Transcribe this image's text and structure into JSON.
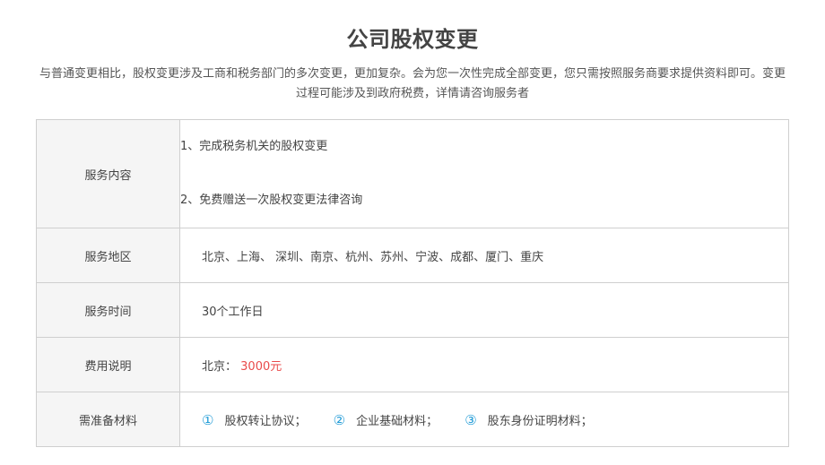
{
  "title": "公司股权变更",
  "intro": "与普通变更相比，股权变更涉及工商和税务部门的多次变更，更加复杂。会为您一次性完成全部变更，您只需按照服务商要求提供资料即可。变更过程可能涉及到政府税费，详情请咨询服务者",
  "rows": {
    "content": {
      "label": "服务内容",
      "items": [
        "1、完成税务机关的股权变更",
        "2、免费赠送一次股权变更法律咨询"
      ]
    },
    "area": {
      "label": "服务地区",
      "value": "北京、上海、 深圳、南京、杭州、苏州、宁波、成都、厦门、重庆"
    },
    "time": {
      "label": "服务时间",
      "value": "30个工作日"
    },
    "fee": {
      "label": "费用说明",
      "city": "北京：",
      "price": "3000元",
      "price_color": "#e94b4b"
    },
    "materials": {
      "label": "需准备材料",
      "items": [
        {
          "num": "①",
          "text": "股权转让协议；"
        },
        {
          "num": "②",
          "text": "企业基础材料；"
        },
        {
          "num": "③",
          "text": "股东身份证明材料；"
        }
      ],
      "num_color": "#1e9ad6"
    }
  }
}
